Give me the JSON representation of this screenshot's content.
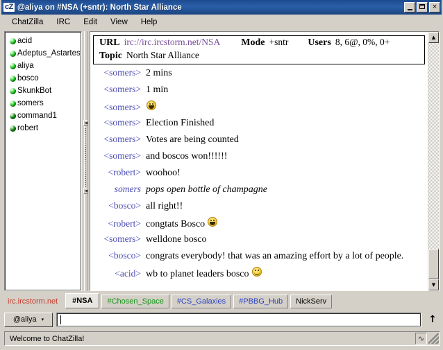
{
  "window": {
    "logo": "cZ",
    "title": "@aliya on #NSA (+sntr): North Star Alliance",
    "minimize_label": "",
    "maximize_label": "",
    "close_label": "×"
  },
  "menu": {
    "items": [
      {
        "label": "ChatZilla"
      },
      {
        "label": "IRC"
      },
      {
        "label": "Edit"
      },
      {
        "label": "View"
      },
      {
        "label": "Help"
      }
    ]
  },
  "userlist": {
    "users": [
      {
        "nick": "acid",
        "status_color": "#22cc22"
      },
      {
        "nick": "Adeptus_Astartes",
        "status_color": "#22cc22"
      },
      {
        "nick": "aliya",
        "status_color": "#22cc22"
      },
      {
        "nick": "bosco",
        "status_color": "#22cc22"
      },
      {
        "nick": "SkunkBot",
        "status_color": "#22cc22"
      },
      {
        "nick": "somers",
        "status_color": "#22cc22"
      },
      {
        "nick": "command1",
        "status_color": "#118811"
      },
      {
        "nick": "robert",
        "status_color": "#118811"
      }
    ]
  },
  "splitter": {
    "collapse_left_glyph": "◄",
    "collapse_right_glyph": "◄"
  },
  "header": {
    "url_label": "URL",
    "url_value": "irc://irc.ircstorm.net/NSA",
    "mode_label": "Mode",
    "mode_value": "+sntr",
    "users_label": "Users",
    "users_value": "8, 6@, 0%, 0+",
    "topic_label": "Topic",
    "topic_value": "North Star Alliance"
  },
  "messages": [
    {
      "nick": "<somers>",
      "text": "2 mins",
      "type": "normal",
      "smiley": ""
    },
    {
      "nick": "<somers>",
      "text": "1 min",
      "type": "normal",
      "smiley": ""
    },
    {
      "nick": "<somers>",
      "text": "",
      "type": "normal",
      "smiley": "grin"
    },
    {
      "nick": "<somers>",
      "text": "Election Finished",
      "type": "normal",
      "smiley": ""
    },
    {
      "nick": "<somers>",
      "text": "Votes are being counted",
      "type": "normal",
      "smiley": ""
    },
    {
      "nick": "<somers>",
      "text": "and boscos won!!!!!!",
      "type": "normal",
      "smiley": ""
    },
    {
      "nick": "<robert>",
      "text": "woohoo!",
      "type": "normal",
      "smiley": ""
    },
    {
      "nick": "somers",
      "text": "pops open bottle of champagne",
      "type": "action",
      "smiley": ""
    },
    {
      "nick": "<bosco>",
      "text": "all right!!",
      "type": "normal",
      "smiley": ""
    },
    {
      "nick": "<robert>",
      "text": "congtats Bosco",
      "type": "normal",
      "smiley": "grin"
    },
    {
      "nick": "<somers>",
      "text": "welldone bosco",
      "type": "normal",
      "smiley": ""
    },
    {
      "nick": "<bosco>",
      "text": "congrats everybody! that was an amazing effort by a lot of people.",
      "type": "normal",
      "smiley": ""
    },
    {
      "nick": "<acid>",
      "text": "wb to planet leaders bosco",
      "type": "normal",
      "smiley": "smile"
    }
  ],
  "scrollbars": {
    "up_glyph": "▲",
    "down_glyph": "▼"
  },
  "tabs": [
    {
      "label": "irc.ircstorm.net",
      "color": "#c43b2a",
      "state": "network"
    },
    {
      "label": "#NSA",
      "color": "#000000",
      "state": "active"
    },
    {
      "label": "#Chosen_Space",
      "color": "#169416",
      "state": "normal"
    },
    {
      "label": "#CS_Galaxies",
      "color": "#2a3fc4",
      "state": "normal"
    },
    {
      "label": "#PBBG_Hub",
      "color": "#2a3fc4",
      "state": "normal"
    },
    {
      "label": "NickServ",
      "color": "#000000",
      "state": "normal"
    }
  ],
  "input": {
    "nick_button_label": "@aliya",
    "nick_button_caret": "▾",
    "value": "",
    "placeholder": "",
    "send_glyph": "↑"
  },
  "status": {
    "text": "Welcome to ChatZilla!",
    "security_glyph": "∿"
  }
}
